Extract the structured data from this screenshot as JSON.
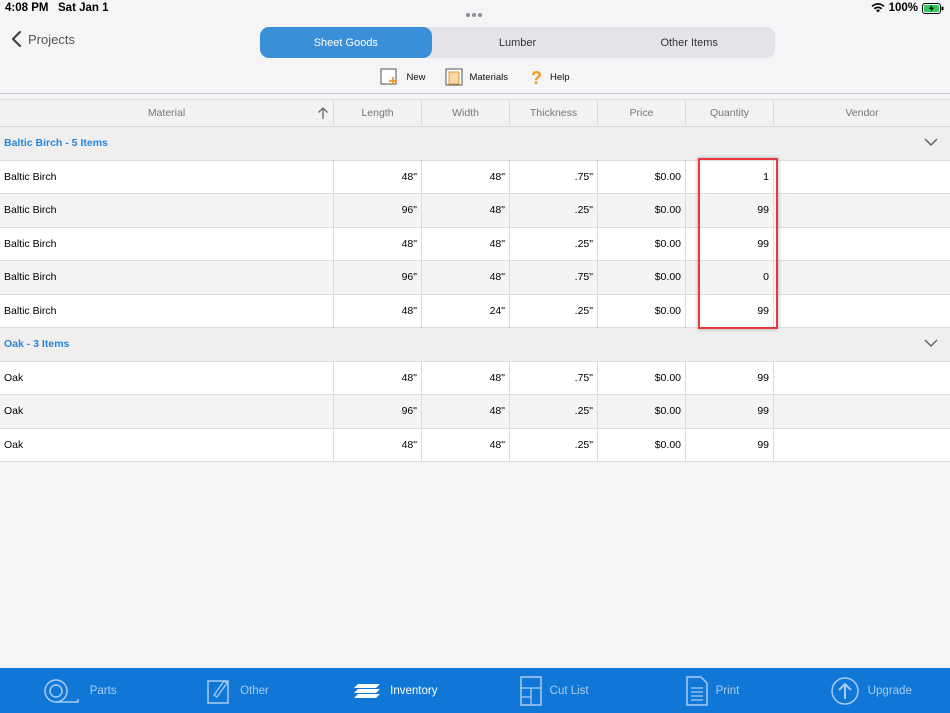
{
  "status": {
    "time": "4:08 PM",
    "date": "Sat Jan 1",
    "battery": "100%"
  },
  "nav": {
    "back_label": "Projects",
    "segments": [
      "Sheet Goods",
      "Lumber",
      "Other Items"
    ]
  },
  "toolbar": {
    "new_label": "New",
    "materials_label": "Materials",
    "help_label": "Help"
  },
  "table": {
    "columns": [
      "Material",
      "Length",
      "Width",
      "Thickness",
      "Price",
      "Quantity",
      "Vendor"
    ],
    "groups": [
      {
        "title": "Baltic Birch - 5 Items",
        "rows": [
          [
            "Baltic Birch",
            "48\"",
            "48\"",
            ".75\"",
            "$0.00",
            "1",
            ""
          ],
          [
            "Baltic Birch",
            "96\"",
            "48\"",
            ".25\"",
            "$0.00",
            "99",
            ""
          ],
          [
            "Baltic Birch",
            "48\"",
            "48\"",
            ".25\"",
            "$0.00",
            "99",
            ""
          ],
          [
            "Baltic Birch",
            "96\"",
            "48\"",
            ".75\"",
            "$0.00",
            "0",
            ""
          ],
          [
            "Baltic Birch",
            "48\"",
            "24\"",
            ".25\"",
            "$0.00",
            "99",
            ""
          ]
        ]
      },
      {
        "title": "Oak - 3 Items",
        "rows": [
          [
            "Oak",
            "48\"",
            "48\"",
            ".75\"",
            "$0.00",
            "99",
            ""
          ],
          [
            "Oak",
            "96\"",
            "48\"",
            ".25\"",
            "$0.00",
            "99",
            ""
          ],
          [
            "Oak",
            "48\"",
            "48\"",
            ".25\"",
            "$0.00",
            "99",
            ""
          ]
        ]
      }
    ]
  },
  "tabbar": {
    "parts": "Parts",
    "other": "Other",
    "inventory": "Inventory",
    "cutlist": "Cut List",
    "print": "Print",
    "upgrade": "Upgrade"
  },
  "colors": {
    "accent": "#3a8fd8",
    "tabbar": "#1077d6",
    "group_title": "#2a85d4",
    "highlight": "#e8383d"
  }
}
